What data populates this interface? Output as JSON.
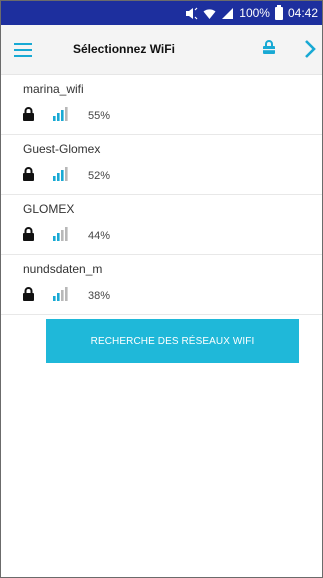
{
  "status_bar": {
    "battery": "100%",
    "time": "04:42"
  },
  "header": {
    "title": "Sélectionnez WiFi",
    "menu_icon": "hamburger-icon",
    "action_icon": "lock-icon",
    "next_icon": "chevron-right-icon"
  },
  "networks": [
    {
      "name": "marina_wifi",
      "signal": "55%",
      "level": 3
    },
    {
      "name": "Guest-Glomex",
      "signal": "52%",
      "level": 3
    },
    {
      "name": "GLOMEX",
      "signal": "44%",
      "level": 2
    },
    {
      "name": "nundsdaten_m",
      "signal": "38%",
      "level": 2
    }
  ],
  "scan_button_label": "RECHERCHE DES RÉSEAUX WIFI",
  "colors": {
    "accent": "#1fb8d9",
    "status_bar": "#1d2f9e",
    "signal_active": "#18a9d4",
    "signal_inactive": "#b8b8b8"
  }
}
